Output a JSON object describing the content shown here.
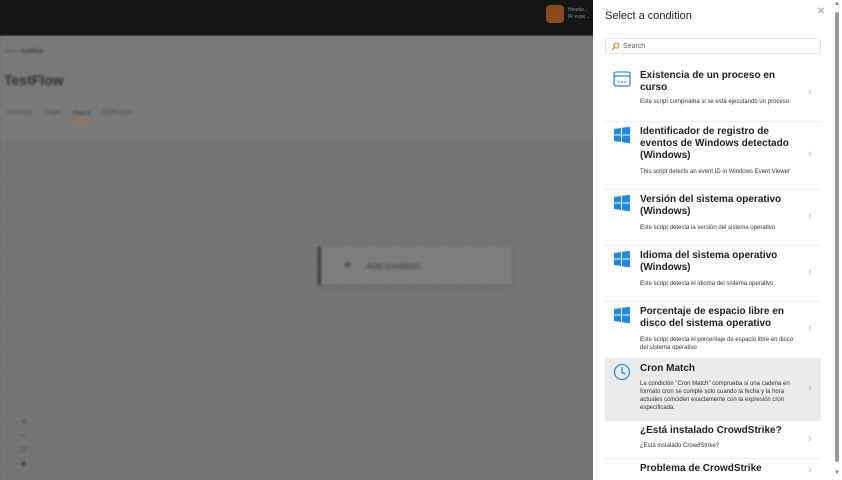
{
  "topbar": {
    "user_name": "Headw...",
    "user_sub": "IR expe..."
  },
  "breadcrumb": {
    "root": "Dex",
    "separator": "/",
    "current": "testflow"
  },
  "page": {
    "title": "TestFlow"
  },
  "tabs": [
    {
      "label": "Overview"
    },
    {
      "label": "Target"
    },
    {
      "label": "Flow ▾"
    },
    {
      "label": "Notification"
    }
  ],
  "canvas": {
    "add_condition_label": "Add condition"
  },
  "zoom": {
    "in": "+",
    "out": "−",
    "fit": "□",
    "dot": "●"
  },
  "panel": {
    "title": "Select a condition",
    "search_placeholder": "Search",
    "items": [
      {
        "title": "Existencia de un proceso en curso",
        "description": "Este script comprueba si se está ejecutando un proceso.",
        "icon": "process-window-icon"
      },
      {
        "title": "Identificador de registro de eventos de Windows detectado (Windows)",
        "description": "This script detects an event ID in Windows Event Viewer",
        "icon": "windows-icon"
      },
      {
        "title": "Versión del sistema operativo (Windows)",
        "description": "Este script detecta la versión del sistema operativo",
        "icon": "windows-icon"
      },
      {
        "title": "Idioma del sistema operativo (Windows)",
        "description": "Este script detecta el idioma del sistema operativo",
        "icon": "windows-icon"
      },
      {
        "title": "Porcentaje de espacio libre en disco del sistema operativo",
        "description": "Este script detecta el porcentaje de espacio libre en disco del sistema operativo",
        "icon": "windows-icon"
      },
      {
        "title": "Cron Match",
        "description": "La condición \"Cron Match\" comprueba si una cadena en formato cron se cumple solo cuando la fecha y la hora actuales coinciden exactamente con la expresión cron especificada.",
        "icon": "clock-icon"
      },
      {
        "title": "¿Está instalado CrowdStrike?",
        "description": "¿Está instalado CrowdStrike?",
        "icon": ""
      },
      {
        "title": "Problema de CrowdStrike",
        "description": "",
        "icon": ""
      }
    ]
  },
  "colors": {
    "accent": "#2f8bd8",
    "windows_blue": "#1e88e5",
    "tab_underline": "#b46a36"
  }
}
